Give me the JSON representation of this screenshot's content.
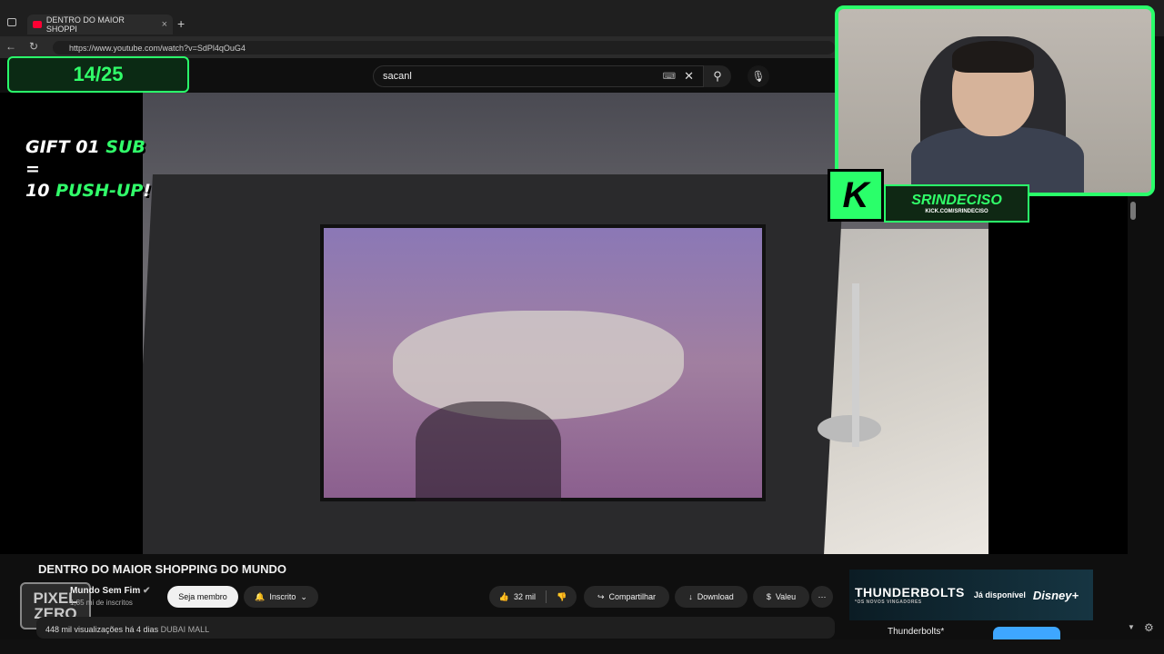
{
  "browser": {
    "tab_title": "DENTRO DO MAIOR SHOPPI",
    "tab_close": "×",
    "new_tab": "+",
    "url": "https://www.youtube.com/watch?v=SdPl4qOuG4"
  },
  "youtube": {
    "search_value": "sacanl",
    "keyboard_icon": "⌨",
    "clear_icon": "✕",
    "search_icon": "⚲",
    "mic_icon": "🎙"
  },
  "overlay": {
    "counter": "14/25",
    "gift_line1_a": "GIFT 01 ",
    "gift_line1_b": "SUB",
    "gift_line1_c": " =",
    "gift_line2_a": "10 ",
    "gift_line2_b": "PUSH-UP",
    "gift_line2_c": "!",
    "streamer_name": "SRINDECISO",
    "streamer_link": "KICK.COM/SRINDECISO",
    "kick_logo": "K"
  },
  "video": {
    "title": "DENTRO DO MAIOR SHOPPING DO MUNDO",
    "channel_name": "Mundo Sem Fim",
    "verified_icon": "✔",
    "subscribers": "1,85 mi de inscritos",
    "join_label": "Seja membro",
    "subscribed_label": "Inscrito",
    "likes": "32 mil",
    "share_label": "Compartilhar",
    "download_label": "Download",
    "thanks_label": "Valeu",
    "more_icon": "⋯",
    "views_date": "448 mil visualizações  há 4 dias",
    "location_tag": "DUBAI MALL",
    "avatar_line1": "PIXEL",
    "avatar_line2": "ZERO"
  },
  "ad": {
    "title": "THUNDERBOLTS",
    "subtitle": "*OS NOVOS VINGADORES",
    "available": "Já disponível",
    "platform": "Disney+",
    "card_title": "Thunderbolts*"
  },
  "colors": {
    "accent_green": "#2aff6a",
    "youtube_red": "#ff0033",
    "bg": "#0f0f0f"
  }
}
